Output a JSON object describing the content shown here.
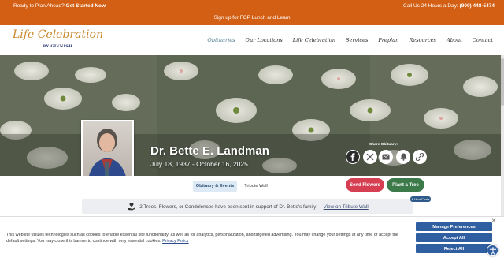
{
  "topbar": {
    "plan_text": "Ready to Plan Ahead?",
    "plan_link": "Get Started Now",
    "call_text": "Call Us 24 Hours a Day:",
    "phone": "(800) 448-5474",
    "signup": "Sign up for FOP Lunch and Learn"
  },
  "logo": {
    "script": "Life Celebration",
    "byline": "BY GIVNISH"
  },
  "nav": {
    "items": [
      "Obituaries",
      "Our Locations",
      "Life Celebration",
      "Services",
      "Preplan",
      "Resources",
      "About",
      "Contact"
    ]
  },
  "obituary": {
    "name": "Dr. Bette E. Landman",
    "born": "July 18, 1937",
    "separator": "-",
    "died": "October 16, 2025",
    "share_label": "Share Obituary:"
  },
  "subnav": {
    "tab_events": "Obituary & Events",
    "tab_tribute": "Tribute Wall",
    "send_flowers": "Send Flowers",
    "plant_tree": "Plant a Tree"
  },
  "banner": {
    "text": "2 Trees, Flowers, or Condolences have been sent in support of Dr. Bette's family –",
    "link": "View on Tribute Wall",
    "badge": "2 New Posts"
  },
  "cookie": {
    "text": "This website utilizes technologies such as cookies to enable essential site functionality, as well as for analytics, personalization, and targeted advertising. You may change your settings at any time or accept the default settings. You may close this banner to continue with only essential cookies.",
    "privacy_link": "Privacy Policy",
    "manage": "Manage Preferences",
    "accept": "Accept All",
    "reject": "Reject All"
  },
  "colors": {
    "topbar": "#d35f14",
    "accent_blue": "#2f5fa0",
    "flowers_btn": "#d63e52",
    "tree_btn": "#3c7a4a"
  }
}
